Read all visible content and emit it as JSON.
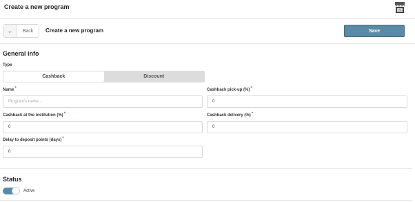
{
  "header": {
    "title": "Create a new program",
    "icon": "store-icon"
  },
  "actionbar": {
    "back_label": "Back",
    "heading": "Create a new program",
    "save_label": "Save"
  },
  "general": {
    "title": "General info",
    "type_label": "Type",
    "type_options": [
      "Cashback",
      "Discount"
    ],
    "selected_type": "Cashback"
  },
  "fields": {
    "name": {
      "label": "Name",
      "placeholder": "Program's name...",
      "value": ""
    },
    "cashback_pickup": {
      "label": "Cashback pick-up  (%)",
      "value": "0"
    },
    "cashback_institution": {
      "label": "Cashback at the institution  (%)",
      "value": "0"
    },
    "cashback_delivery": {
      "label": "Cashback delivery  (%)",
      "value": "0"
    },
    "delay_deposit": {
      "label": "Delay to deposit points (days)",
      "value": "0"
    }
  },
  "status": {
    "title": "Status",
    "toggle_label": "Active",
    "active": true
  },
  "colors": {
    "accent": "#5a8aa5",
    "required": "#dd3333"
  }
}
